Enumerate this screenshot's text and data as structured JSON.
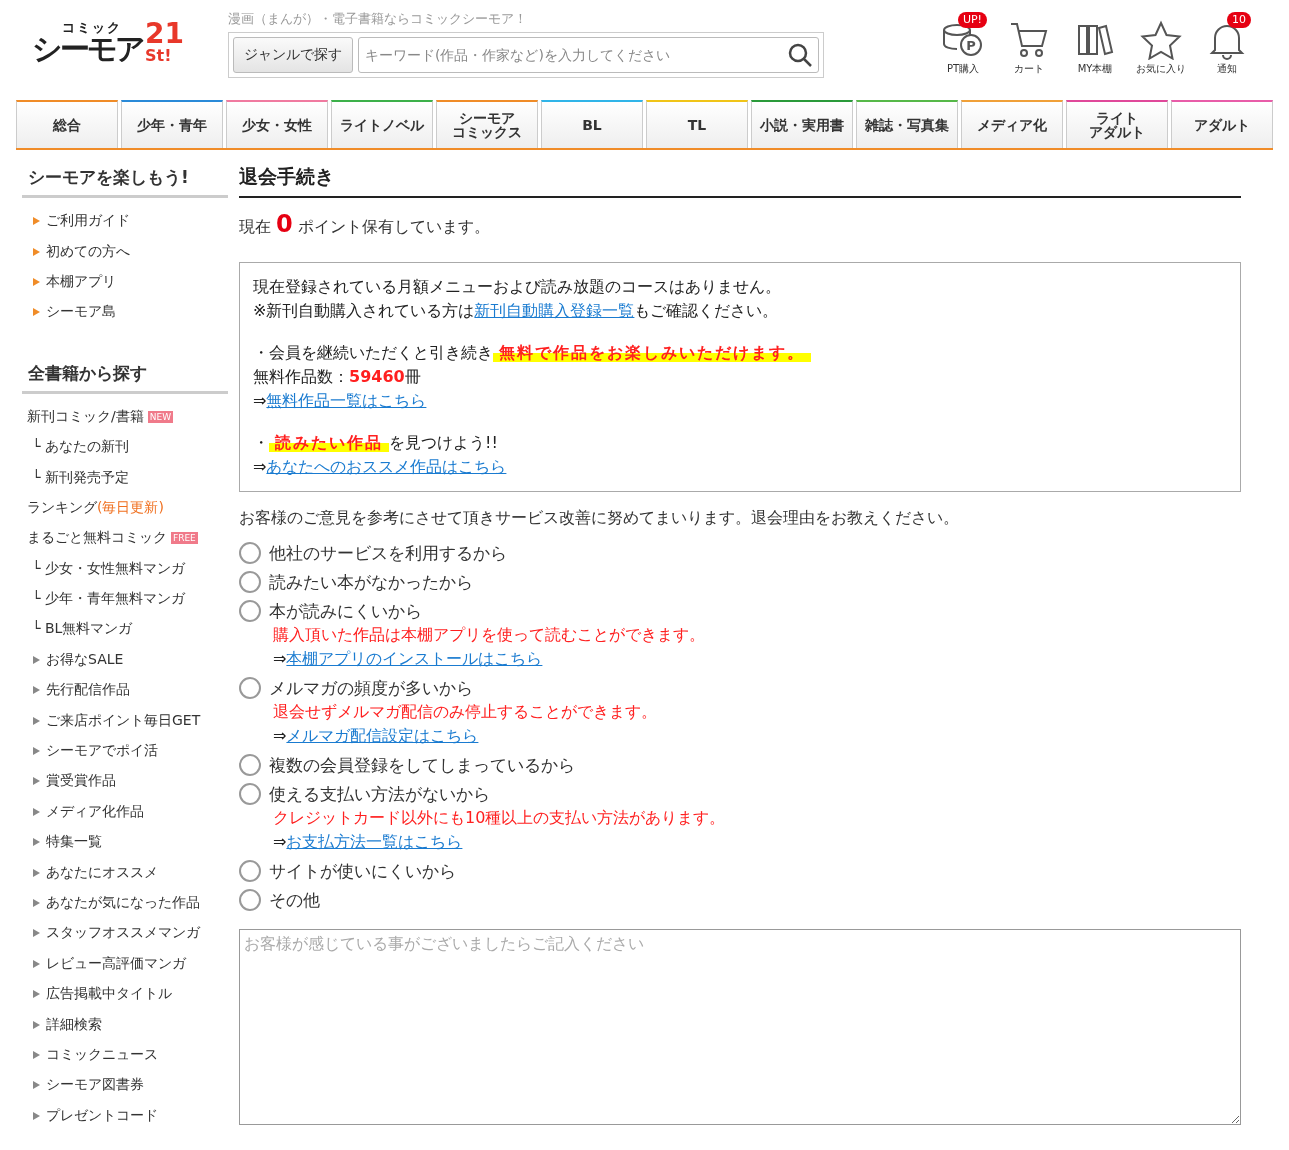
{
  "header": {
    "logo_small": "コミック",
    "logo_main": "シーモア",
    "logo_num": "21",
    "logo_sub": "St!",
    "tagline": "漫画（まんが）・電子書籍ならコミックシーモア！",
    "genre_button": "ジャンルで探す",
    "search": {
      "placeholder": "キーワード(作品・作家など)を入力してください"
    },
    "icons": [
      {
        "kind": "points",
        "label": "PT購入",
        "badge": "UP!",
        "mark": "P"
      },
      {
        "kind": "cart",
        "label": "カート"
      },
      {
        "kind": "shelf",
        "label": "MY本棚"
      },
      {
        "kind": "star",
        "label": "お気に入り"
      },
      {
        "kind": "bell",
        "label": "通知",
        "badge": "10"
      }
    ]
  },
  "nav": [
    {
      "label": "総合",
      "color": "#f08c28"
    },
    {
      "label": "少年・青年",
      "color": "#2a8ad8"
    },
    {
      "label": "少女・女性",
      "color": "#f07aa0"
    },
    {
      "label": "ライトノベル",
      "color": "#3cb04a"
    },
    {
      "lines": [
        "シーモア",
        "コミックス"
      ],
      "color": "#f08c28"
    },
    {
      "label": "BL",
      "color": "#30b4e8"
    },
    {
      "label": "TL",
      "color": "#f0c418"
    },
    {
      "label": "小説・実用書",
      "color": "#2a9a3a"
    },
    {
      "label": "雑誌・写真集",
      "color": "#56b848"
    },
    {
      "label": "メディア化",
      "color": "#f0a038"
    },
    {
      "lines": [
        "ライト",
        "アダルト"
      ],
      "color": "#e0489a"
    },
    {
      "label": "アダルト",
      "color": "#e85ca8"
    }
  ],
  "sidebar": [
    {
      "title": "シーモアを楽しもう!",
      "items": [
        {
          "kind": "bullet",
          "label": "ご利用ガイド"
        },
        {
          "kind": "bullet",
          "label": "初めての方へ"
        },
        {
          "kind": "bullet",
          "label": "本棚アプリ"
        },
        {
          "kind": "bullet",
          "label": "シーモア島"
        }
      ]
    },
    {
      "title": "全書籍から探す",
      "items": [
        {
          "kind": "plain",
          "label": "新刊コミック/書籍",
          "badge": "NEW"
        },
        {
          "kind": "sub",
          "label": "└ あなたの新刊"
        },
        {
          "kind": "sub",
          "label": "└ 新刊発売予定"
        },
        {
          "kind": "plain",
          "label": "ランキング",
          "note": "(毎日更新)"
        },
        {
          "kind": "plain",
          "label": "まるごと無料コミック",
          "badge": "FREE"
        },
        {
          "kind": "sub",
          "label": "└ 少女・女性無料マンガ"
        },
        {
          "kind": "sub",
          "label": "└ 少年・青年無料マンガ"
        },
        {
          "kind": "sub",
          "label": "└ BL無料マンガ"
        },
        {
          "kind": "arrow",
          "label": "お得なSALE"
        },
        {
          "kind": "arrow",
          "label": "先行配信作品"
        },
        {
          "kind": "arrow",
          "label": "ご来店ポイント毎日GET"
        },
        {
          "kind": "arrow",
          "label": "シーモアでポイ活"
        },
        {
          "kind": "arrow",
          "label": "賞受賞作品"
        },
        {
          "kind": "arrow",
          "label": "メディア化作品"
        },
        {
          "kind": "arrow",
          "label": "特集一覧"
        },
        {
          "kind": "arrow",
          "label": "あなたにオススメ"
        },
        {
          "kind": "arrow",
          "label": "あなたが気になった作品"
        },
        {
          "kind": "arrow",
          "label": "スタッフオススメマンガ"
        },
        {
          "kind": "arrow",
          "label": "レビュー高評価マンガ"
        },
        {
          "kind": "arrow",
          "label": "広告掲載中タイトル"
        },
        {
          "kind": "arrow",
          "label": "詳細検索"
        },
        {
          "kind": "arrow",
          "label": "コミックニュース"
        },
        {
          "kind": "arrow",
          "label": "シーモア図書券"
        },
        {
          "kind": "arrow",
          "label": "プレゼントコード"
        }
      ]
    }
  ],
  "main": {
    "title": "退会手続き",
    "points": {
      "before": "現在",
      "value": "0",
      "after": "ポイント保有しています。"
    },
    "info": {
      "line1": "現在登録されている月額メニューおよび読み放題のコースはありません。",
      "line2": {
        "before": "※新刊自動購入されている方は",
        "link": "新刊自動購入登録一覧",
        "after": "もご確認ください。"
      },
      "continue": {
        "lead": "・会員を継続いただくと引き続き",
        "highlight": "無料で作品をお楽しみいただけます。"
      },
      "free_count": {
        "label": "無料作品数：",
        "value": "59460",
        "unit": "冊"
      },
      "free_link": {
        "arrow": "⇒",
        "link": "無料作品一覧はこちら"
      },
      "find": {
        "lead": "・",
        "highlight": "読みたい作品",
        "after": "を見つけよう!!"
      },
      "rec_link": {
        "arrow": "⇒",
        "link": "あなたへのおススメ作品はこちら"
      }
    },
    "prompt": "お客様のご意見を参考にさせて頂きサービス改善に努めてまいります。退会理由をお教えください。",
    "reasons": [
      {
        "label": "他社のサービスを利用するから",
        "selected": false
      },
      {
        "label": "読みたい本がなかったから",
        "selected": false
      },
      {
        "label": "本が読みにくいから",
        "selected": false,
        "note": "購入頂いた作品は本棚アプリを使って読むことができます。",
        "arrow": "⇒",
        "link": "本棚アプリのインストールはこちら"
      },
      {
        "label": "メルマガの頻度が多いから",
        "selected": false,
        "note": "退会せずメルマガ配信のみ停止することができます。",
        "arrow": "⇒",
        "link": "メルマガ配信設定はこちら"
      },
      {
        "label": "複数の会員登録をしてしまっているから",
        "selected": false
      },
      {
        "label": "使える支払い方法がないから",
        "selected": false,
        "note": "クレジットカード以外にも10種以上の支払い方法があります。",
        "arrow": "⇒",
        "link": "お支払方法一覧はこちら"
      },
      {
        "label": "サイトが使いにくいから",
        "selected": false
      },
      {
        "label": "その他",
        "selected": false
      }
    ],
    "comment": {
      "placeholder": "お客様が感じている事がございましたらご記入ください"
    }
  }
}
